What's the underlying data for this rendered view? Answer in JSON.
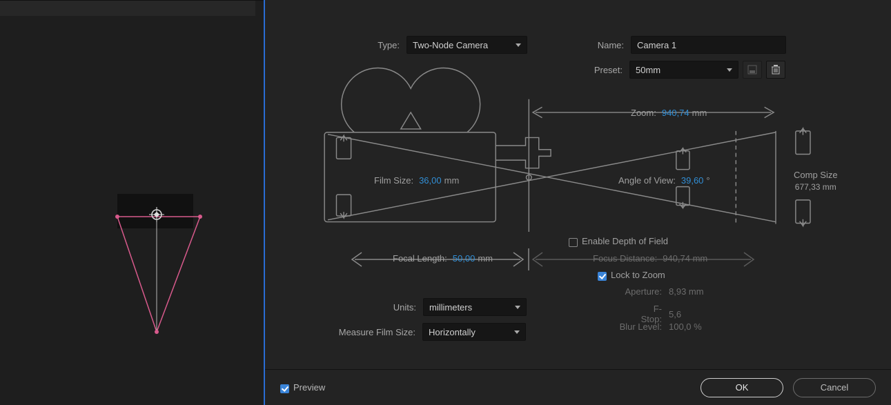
{
  "type": {
    "label": "Type:",
    "value": "Two-Node Camera"
  },
  "name": {
    "label": "Name:",
    "value": "Camera 1"
  },
  "preset": {
    "label": "Preset:",
    "value": "50mm"
  },
  "diagram": {
    "zoom": {
      "label": "Zoom:",
      "value": "940,74",
      "unit": "mm"
    },
    "filmSize": {
      "label": "Film Size:",
      "value": "36,00",
      "unit": "mm"
    },
    "angleOfView": {
      "label": "Angle of View:",
      "value": "39,60",
      "unit": "°"
    },
    "compSize": {
      "label": "Comp Size",
      "value": "677,33 mm"
    },
    "focalLength": {
      "label": "Focal Length:",
      "value": "50,00",
      "unit": "mm"
    }
  },
  "depthOfField": {
    "enable": {
      "label": "Enable Depth of Field",
      "checked": false
    },
    "focusDistance": {
      "label": "Focus Distance:",
      "value": "940,74 mm"
    },
    "lockToZoom": {
      "label": "Lock to Zoom",
      "checked": true
    },
    "aperture": {
      "label": "Aperture:",
      "value": "8,93 mm"
    },
    "fstop": {
      "label": "F-Stop:",
      "value": "5,6"
    },
    "blurLevel": {
      "label": "Blur Level:",
      "value": "100,0 %"
    }
  },
  "units": {
    "label": "Units:",
    "value": "millimeters"
  },
  "measureFilmSize": {
    "label": "Measure Film Size:",
    "value": "Horizontally"
  },
  "footer": {
    "preview": "Preview",
    "ok": "OK",
    "cancel": "Cancel"
  }
}
